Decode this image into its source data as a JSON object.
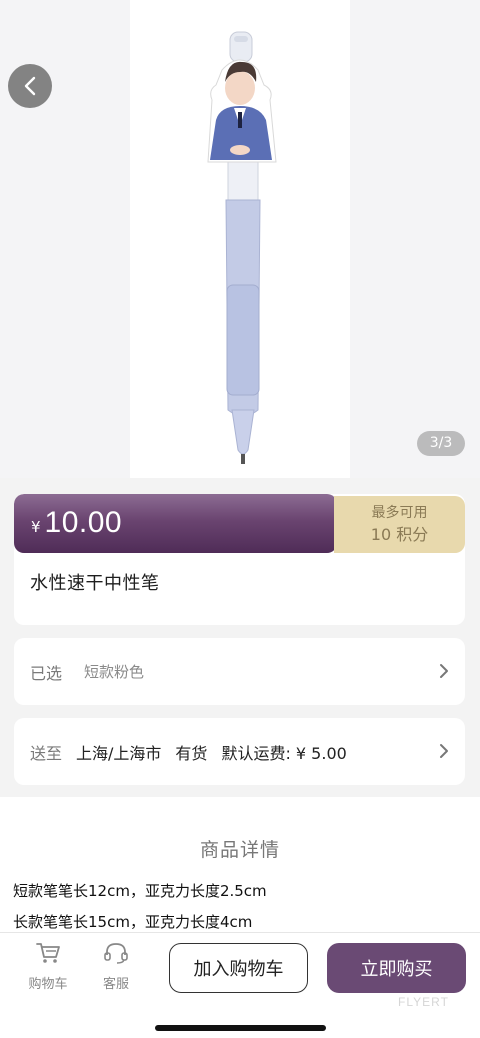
{
  "gallery": {
    "counter": "3/3"
  },
  "price": {
    "currency": "¥",
    "amount": "10.00",
    "points_line1": "最多可用",
    "points_line2": "10 积分"
  },
  "product": {
    "title": "水性速干中性笔"
  },
  "selected": {
    "label": "已选",
    "value": "短款粉色"
  },
  "shipping": {
    "label": "送至",
    "location": "上海/上海市",
    "stock": "有货",
    "fee": "默认运费: ¥ 5.00"
  },
  "details": {
    "title": "商品详情",
    "lines": [
      "短款笔笔长12cm，亚克力长度2.5cm",
      "长款笔笔长15cm，亚克力长度4cm"
    ]
  },
  "bottom_bar": {
    "cart_tab": "购物车",
    "service_tab": "客服",
    "add_to_cart": "加入购物车",
    "buy_now": "立即购买"
  },
  "watermark": "FLYERT",
  "colors": {
    "accent": "#6a4a74",
    "points_bg": "#e8d9ad"
  }
}
